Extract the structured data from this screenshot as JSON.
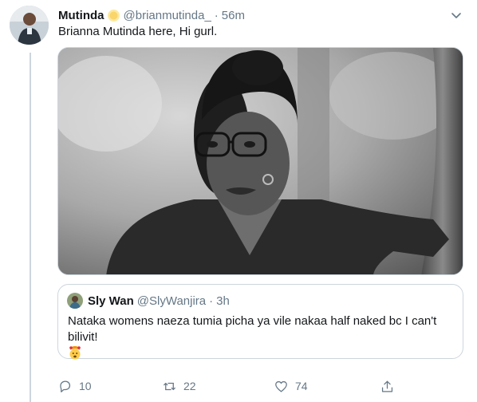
{
  "tweet": {
    "display_name": "Mutinda",
    "handle": "@brianmutinda_",
    "separator": "·",
    "time": "56m",
    "text": "Brianna Mutinda here, Hi gurl.",
    "badge_icon": "sun-emoji-icon",
    "avatar_icon": "profile-avatar"
  },
  "media": {
    "icon": "grayscale-photo-woman-glasses"
  },
  "quote": {
    "display_name": "Sly Wan",
    "handle": "@SlyWanjira",
    "separator": "·",
    "time": "3h",
    "text": "Nataka womens naeza tumia picha ya vile nakaa half naked bc I can't bilivit!",
    "emoji_icon": "exploding-head-emoji"
  },
  "actions": {
    "reply_count": "10",
    "retweet_count": "22",
    "like_count": "74"
  },
  "colors": {
    "secondary_text": "#657786",
    "border": "#ccd6dd",
    "primary_text": "#14171a"
  }
}
